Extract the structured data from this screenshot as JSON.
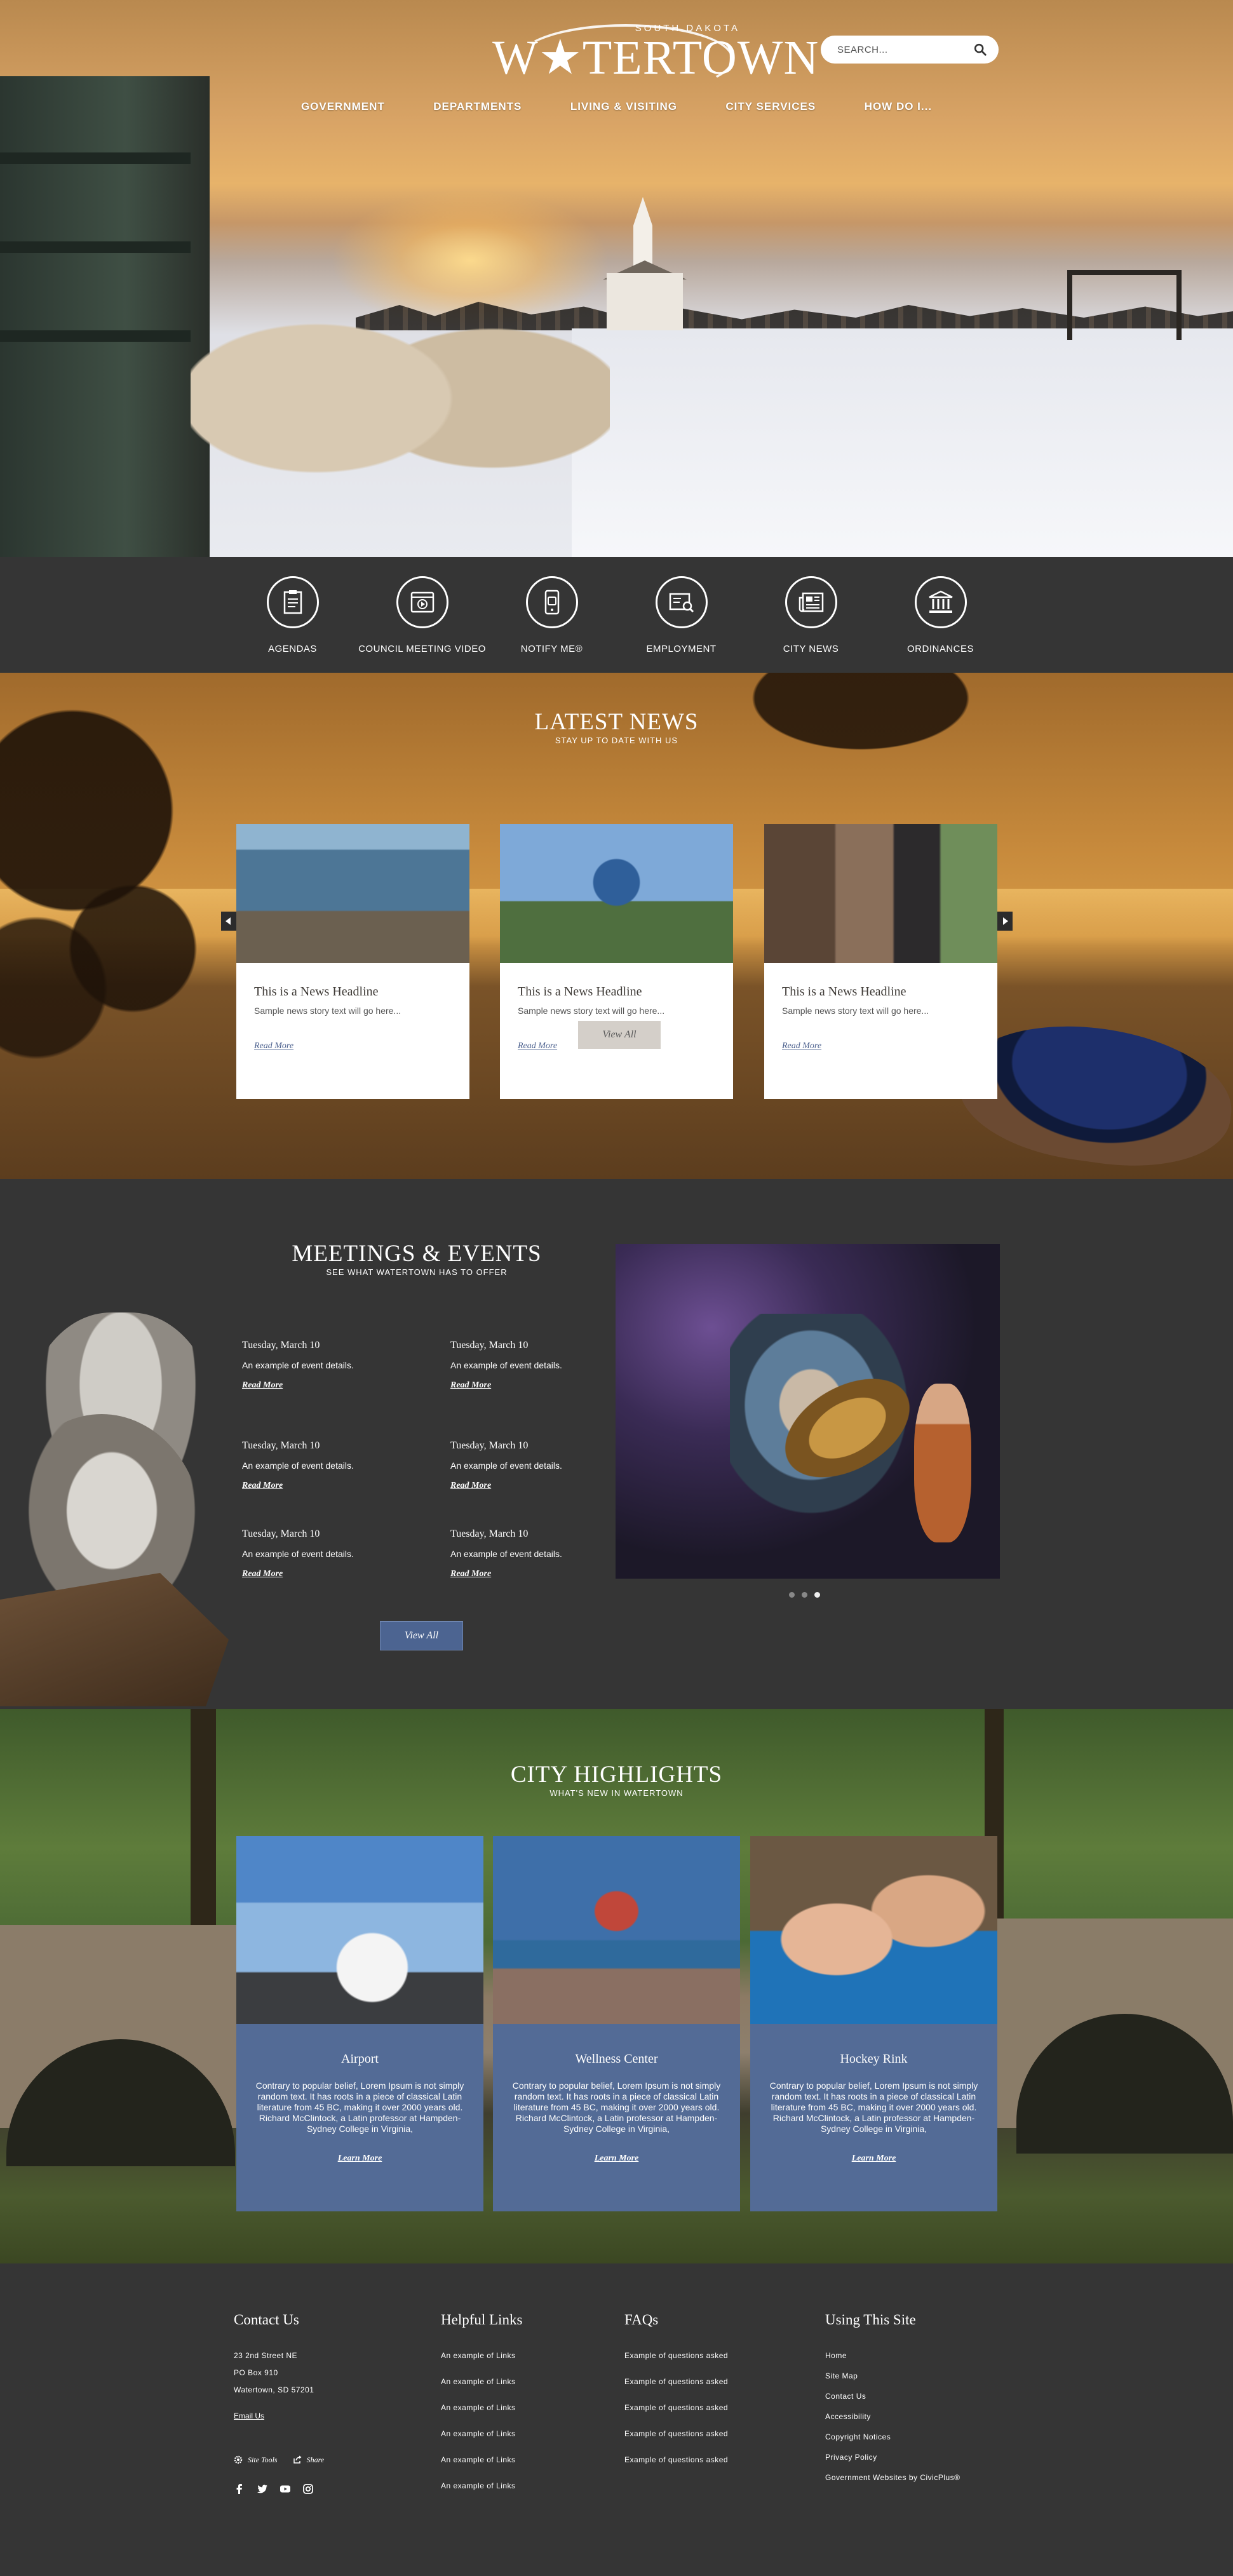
{
  "header": {
    "logo_state": "SOUTH DAKOTA",
    "logo_city": "W★TERTOWN",
    "search_placeholder": "SEARCH...",
    "nav": [
      "GOVERNMENT",
      "DEPARTMENTS",
      "LIVING & VISITING",
      "CITY SERVICES",
      "HOW DO I..."
    ]
  },
  "quick_links": [
    {
      "label": "AGENDAS",
      "icon": "agenda-icon"
    },
    {
      "label": "COUNCIL MEETING VIDEO",
      "icon": "video-icon"
    },
    {
      "label": "NOTIFY ME®",
      "icon": "phone-icon"
    },
    {
      "label": "EMPLOYMENT",
      "icon": "employment-icon"
    },
    {
      "label": "CITY NEWS",
      "icon": "newspaper-icon"
    },
    {
      "label": "ORDINANCES",
      "icon": "courthouse-icon"
    }
  ],
  "news": {
    "title": "LATEST NEWS",
    "subtitle": "STAY UP TO DATE WITH US",
    "cards": [
      {
        "headline": "This is a News Headline",
        "text": "Sample news story text will go here...",
        "link": "Read More"
      },
      {
        "headline": "This is a News Headline",
        "text": "Sample news story text will go here...",
        "link": "Read More"
      },
      {
        "headline": "This is a News Headline",
        "text": "Sample news story text will go here...",
        "link": "Read More"
      }
    ],
    "view_all": "View All"
  },
  "meetings": {
    "title": "MEETINGS & EVENTS",
    "subtitle": "SEE WHAT WATERTOWN HAS TO OFFER",
    "events": [
      {
        "date": "Tuesday, March 10",
        "text": "An example of event details.",
        "link": "Read More"
      },
      {
        "date": "Tuesday, March 10",
        "text": "An example of event details.",
        "link": "Read More"
      },
      {
        "date": "Tuesday, March 10",
        "text": "An example of event details.",
        "link": "Read More"
      },
      {
        "date": "Tuesday, March 10",
        "text": "An example of event details.",
        "link": "Read More"
      },
      {
        "date": "Tuesday, March 10",
        "text": "An example of event details.",
        "link": "Read More"
      },
      {
        "date": "Tuesday, March 10",
        "text": "An example of event details.",
        "link": "Read More"
      }
    ],
    "view_all": "View All"
  },
  "highlights": {
    "title": "CITY HIGHLIGHTS",
    "subtitle": "WHAT'S NEW IN WATERTOWN",
    "cards": [
      {
        "title": "Airport",
        "body": "Contrary to popular belief, Lorem Ipsum is not simply random text. It has roots in a piece of classical Latin literature from 45 BC, making it over 2000 years old. Richard McClintock, a Latin professor at Hampden-Sydney College in Virginia,",
        "link": "Learn More"
      },
      {
        "title": "Wellness Center",
        "body": "Contrary to popular belief, Lorem Ipsum is not simply random text. It has roots in a piece of classical Latin literature from 45 BC, making it over 2000 years old. Richard McClintock, a Latin professor at Hampden-Sydney College in Virginia,",
        "link": "Learn More"
      },
      {
        "title": "Hockey Rink",
        "body": "Contrary to popular belief, Lorem Ipsum is not simply random text. It has roots in a piece of classical Latin literature from 45 BC, making it over 2000 years old. Richard McClintock, a Latin professor at Hampden-Sydney College in Virginia,",
        "link": "Learn More"
      }
    ]
  },
  "footer": {
    "contact": {
      "title": "Contact Us",
      "lines": [
        "23 2nd Street NE",
        "PO Box 910",
        "Watertown, SD 57201"
      ],
      "email": "Email Us",
      "site_tools": "Site Tools",
      "share": "Share"
    },
    "helpful": {
      "title": "Helpful Links",
      "items": [
        "An example of Links",
        "An example of Links",
        "An example of Links",
        "An example of Links",
        "An example of Links",
        "An example of Links"
      ]
    },
    "faqs": {
      "title": "FAQs",
      "items": [
        "Example of questions asked",
        "Example of questions asked",
        "Example of questions asked",
        "Example of questions asked",
        "Example of questions asked"
      ]
    },
    "site": {
      "title": "Using This Site",
      "items": [
        "Home",
        "Site Map",
        "Contact Us",
        "Accessibility",
        "Copyright Notices",
        "Privacy Policy",
        "Government Websites by CivicPlus®"
      ]
    },
    "social": [
      "facebook-icon",
      "twitter-icon",
      "youtube-icon",
      "instagram-icon"
    ]
  }
}
